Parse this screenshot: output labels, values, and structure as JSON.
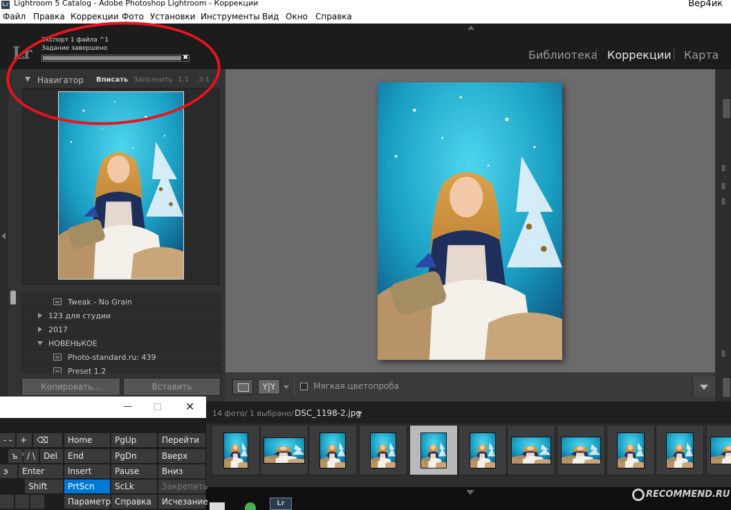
{
  "window": {
    "title": "Lightroom 5 Catalog - Adobe Photoshop Lightroom - Коррекции",
    "user": "Вер4ик",
    "app_icon": "Lr"
  },
  "menubar": [
    "Файл",
    "Правка",
    "Коррекции",
    "Фото",
    "Установки",
    "Инструменты",
    "Вид",
    "Окно",
    "Справка"
  ],
  "identity": {
    "logo": "Lr",
    "export_title": "Экспорт 1 файла ^1",
    "export_status": "Задание завершено",
    "progress_percent": 100,
    "cancel_glyph": "✖"
  },
  "modules": [
    {
      "label": "Библиотека",
      "active": false
    },
    {
      "label": "Коррекции",
      "active": true
    },
    {
      "label": "Карта",
      "active": false
    }
  ],
  "navigator": {
    "title": "Навигатор",
    "options": [
      {
        "label": "Вписать",
        "active": true
      },
      {
        "label": "Заполнить",
        "active": false
      },
      {
        "label": "1:1",
        "active": false
      },
      {
        "label": "3:1",
        "active": false
      }
    ]
  },
  "presets": [
    {
      "label": "Tweak - No Grain",
      "type": "item"
    },
    {
      "label": "123 для студии",
      "type": "folder-collapsed"
    },
    {
      "label": "2017",
      "type": "folder-collapsed"
    },
    {
      "label": "НОВЕНЬКОЕ",
      "type": "folder-expanded"
    },
    {
      "label": "Photo-standard.ru: 439",
      "type": "item"
    },
    {
      "label": "Preset 1.2",
      "type": "item"
    }
  ],
  "buttons": {
    "copy": "Копировать...",
    "paste": "Вставить"
  },
  "toolbar": {
    "compare_glyph": "Y|Y",
    "soft_proof": "Мягкая цветопроба"
  },
  "filmstrip": {
    "count": "14 фото/",
    "selected": "1 выбрано/",
    "filename": "DSC_1198-2.jpg",
    "thumbnails": 11,
    "selected_index": 4
  },
  "keyboard": {
    "min_glyph": "—",
    "close_glyph": "✕",
    "keys": [
      "Home",
      "PgUp",
      "Перейти",
      "End",
      "PgDn",
      "Вверх",
      "Insert",
      "Pause",
      "Вниз",
      "PrtScn",
      "ScLk",
      "Закрепить",
      "Параметры",
      "Справка",
      "Исчезание",
      "Del",
      "Enter",
      "Shift",
      "- -",
      "+ =",
      "⌫",
      "ъ",
      "/ \\",
      "э"
    ]
  },
  "watermark": "RECOMMEND.RU",
  "taskbar": {
    "lr": "Lr"
  },
  "colors": {
    "annotation": "#e8141d",
    "highlight_key": "#0078d7"
  }
}
